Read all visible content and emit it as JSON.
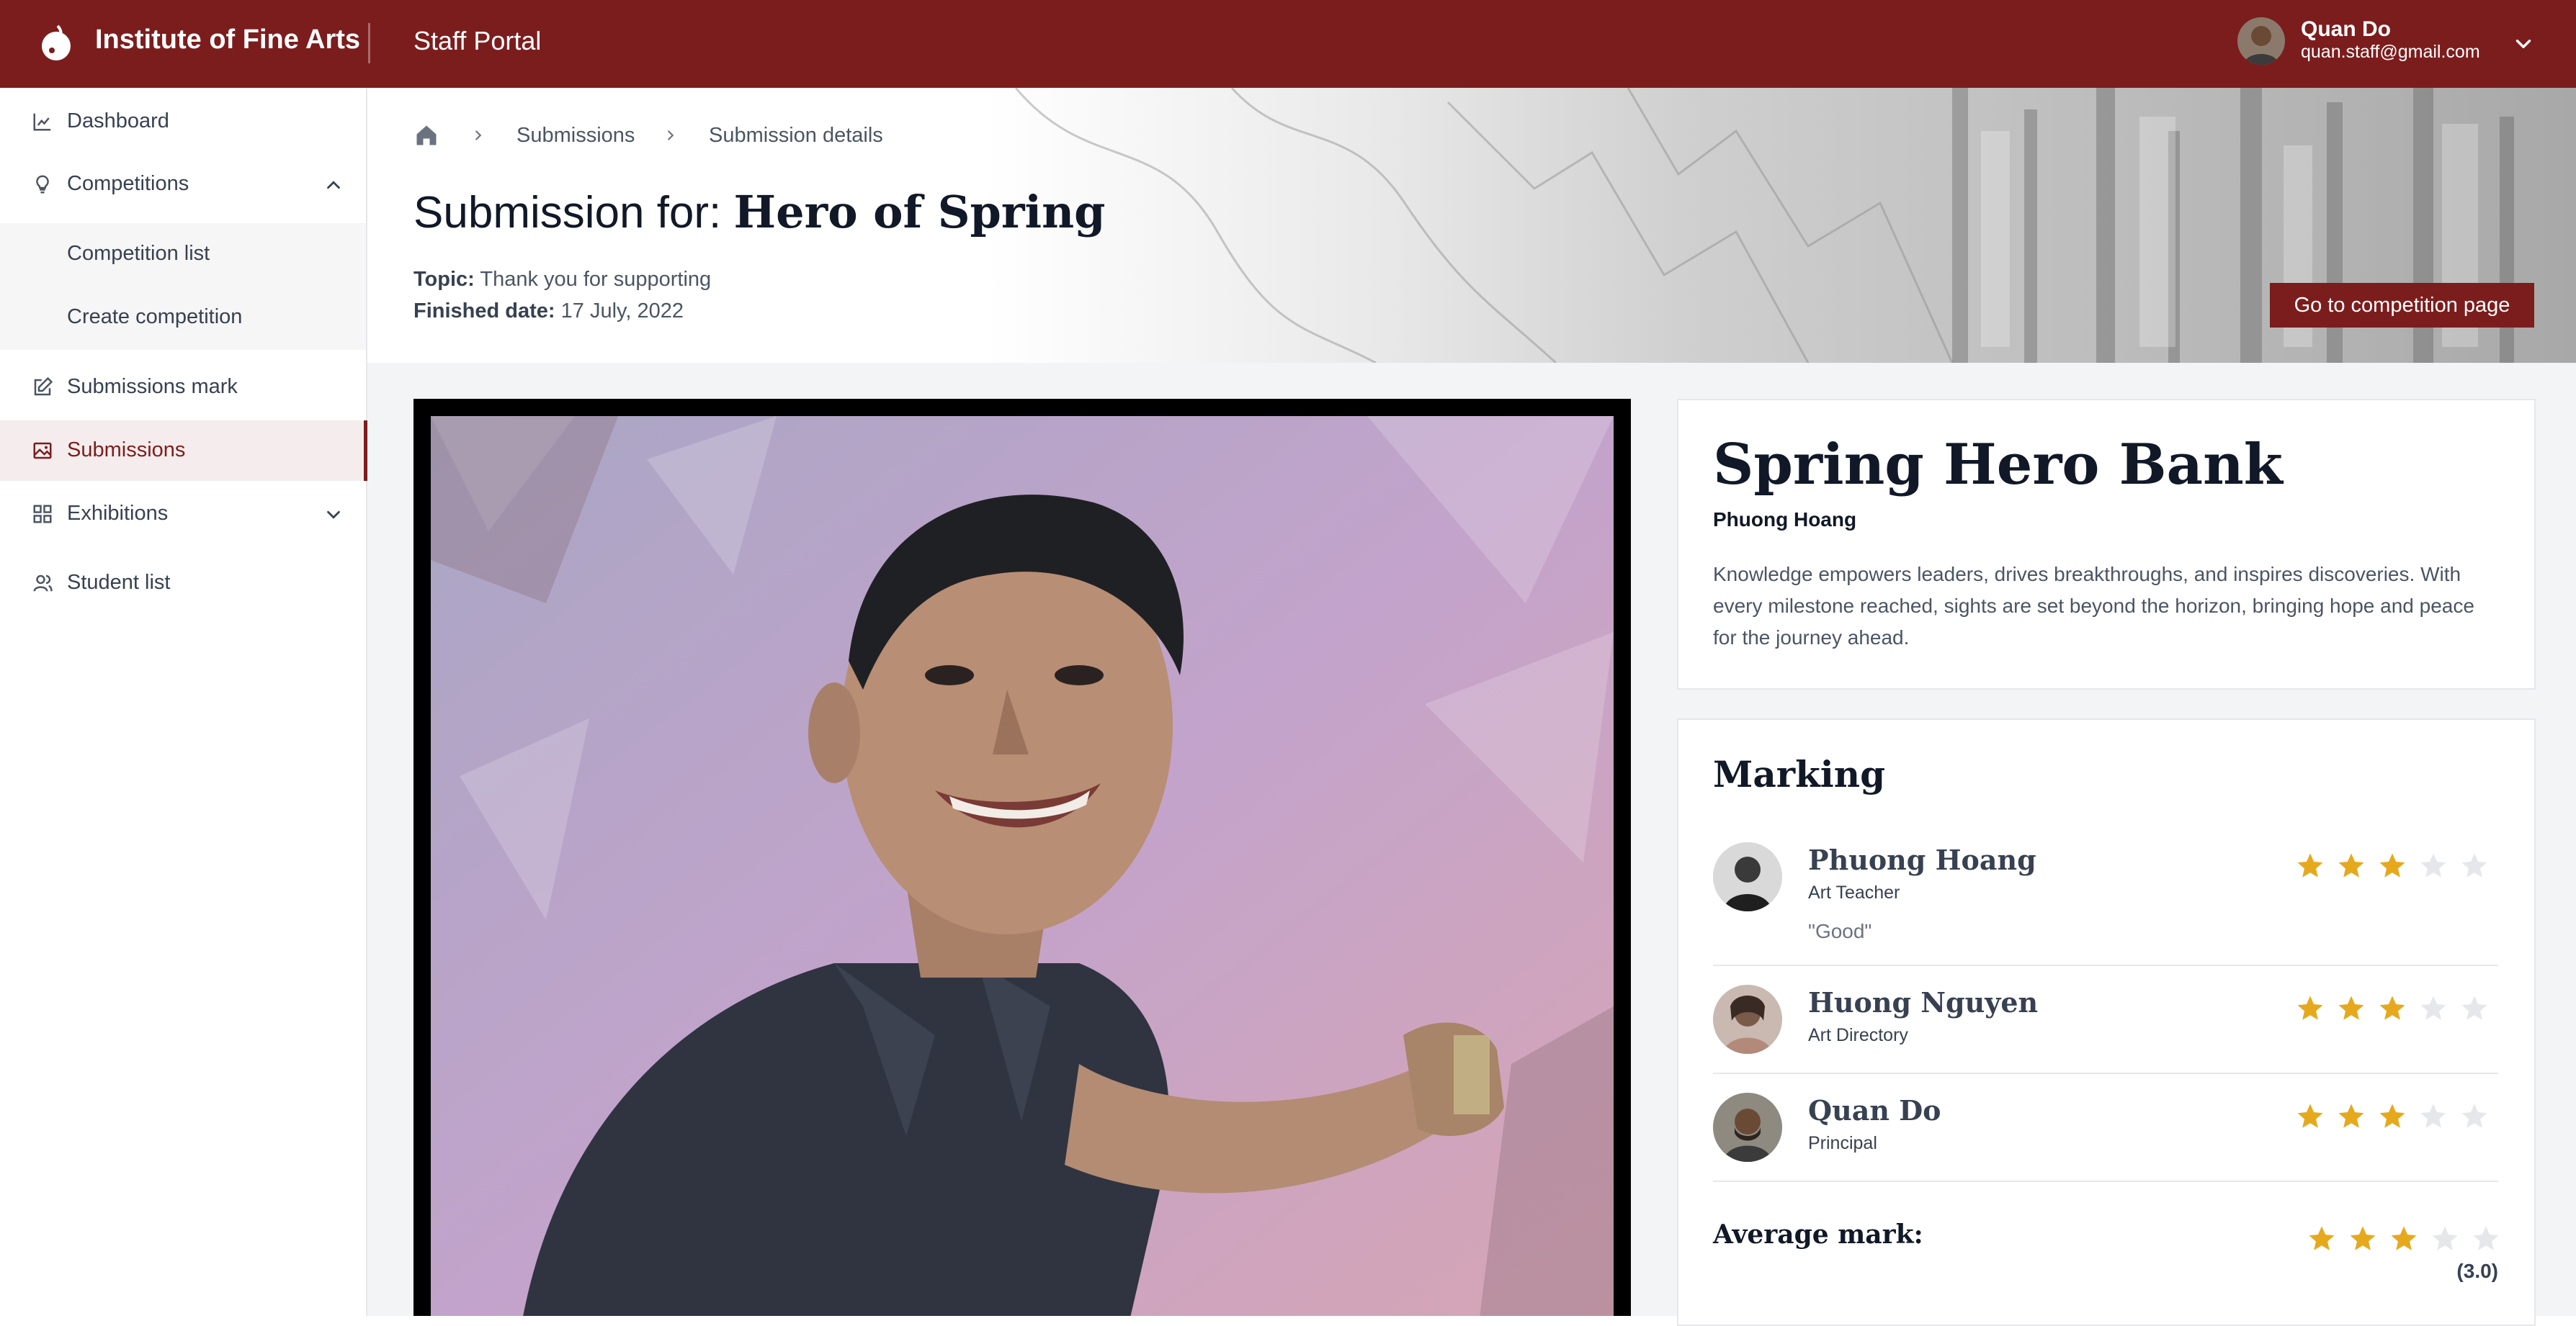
{
  "header": {
    "brand": "Institute of Fine Arts",
    "portal": "Staff Portal",
    "user": {
      "name": "Quan Do",
      "email": "quan.staff@gmail.com"
    }
  },
  "sidebar": {
    "items": [
      {
        "label": "Dashboard",
        "icon": "chart-icon"
      },
      {
        "label": "Competitions",
        "icon": "lightbulb-icon",
        "expanded": true
      },
      {
        "label": "Submissions mark",
        "icon": "edit-icon"
      },
      {
        "label": "Submissions",
        "icon": "image-icon",
        "active": true
      },
      {
        "label": "Exhibitions",
        "icon": "grid-icon",
        "expanded": false
      },
      {
        "label": "Student list",
        "icon": "users-icon"
      }
    ],
    "competition_sub": [
      "Competition list",
      "Create competition"
    ]
  },
  "breadcrumb": {
    "items": [
      "Submissions",
      "Submission details"
    ]
  },
  "page": {
    "title_prefix": "Submission for:",
    "title_name": "Hero of Spring",
    "topic_label": "Topic:",
    "topic_value": "Thank you for supporting",
    "finished_label": "Finished date:",
    "finished_value": "17 July, 2022",
    "go_button": "Go to competition page"
  },
  "submission": {
    "title": "Spring Hero Bank",
    "author": "Phuong Hoang",
    "description": "Knowledge empowers leaders, drives breakthroughs, and inspires discoveries. With every milestone reached, sights are set beyond the horizon, bringing hope and peace for the journey ahead."
  },
  "marking": {
    "title": "Marking",
    "markers": [
      {
        "name": "Phuong Hoang",
        "role": "Art Teacher",
        "comment": "\"Good\"",
        "rating": 3,
        "max": 5
      },
      {
        "name": "Huong Nguyen",
        "role": "Art Directory",
        "comment": "",
        "rating": 3,
        "max": 5
      },
      {
        "name": "Quan Do",
        "role": "Principal",
        "comment": "",
        "rating": 3,
        "max": 5
      }
    ],
    "average_label": "Average mark:",
    "average_value": "(3.0)",
    "average_rating": 3
  },
  "colors": {
    "brand": "#7c1d1d",
    "star_filled": "#e6a91e",
    "star_empty": "#e5e7eb"
  }
}
